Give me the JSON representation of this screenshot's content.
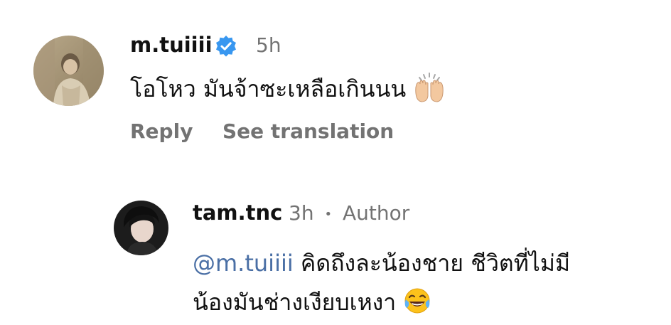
{
  "comment": {
    "username": "m.tuiiii",
    "verified": true,
    "time": "5h",
    "text": "โอโหว มันจ้าซะเหลือเกินนน",
    "emoji": "raising-hands",
    "reply_label": "Reply",
    "see_translation_label": "See translation"
  },
  "reply": {
    "username": "tam.tnc",
    "time": "3h",
    "separator": "•",
    "author_label": "Author",
    "mention": "@m.tuiiii",
    "text_line1": "คิดถึงละน้องชาย ชีวิตที่ไม่มี",
    "text_line2": "น้องมันช่างเงียบเหงา",
    "emoji": "face-with-tears-of-joy"
  },
  "colors": {
    "verified": "#3897f0",
    "meta": "#737373",
    "mention": "#4a6fa5"
  }
}
